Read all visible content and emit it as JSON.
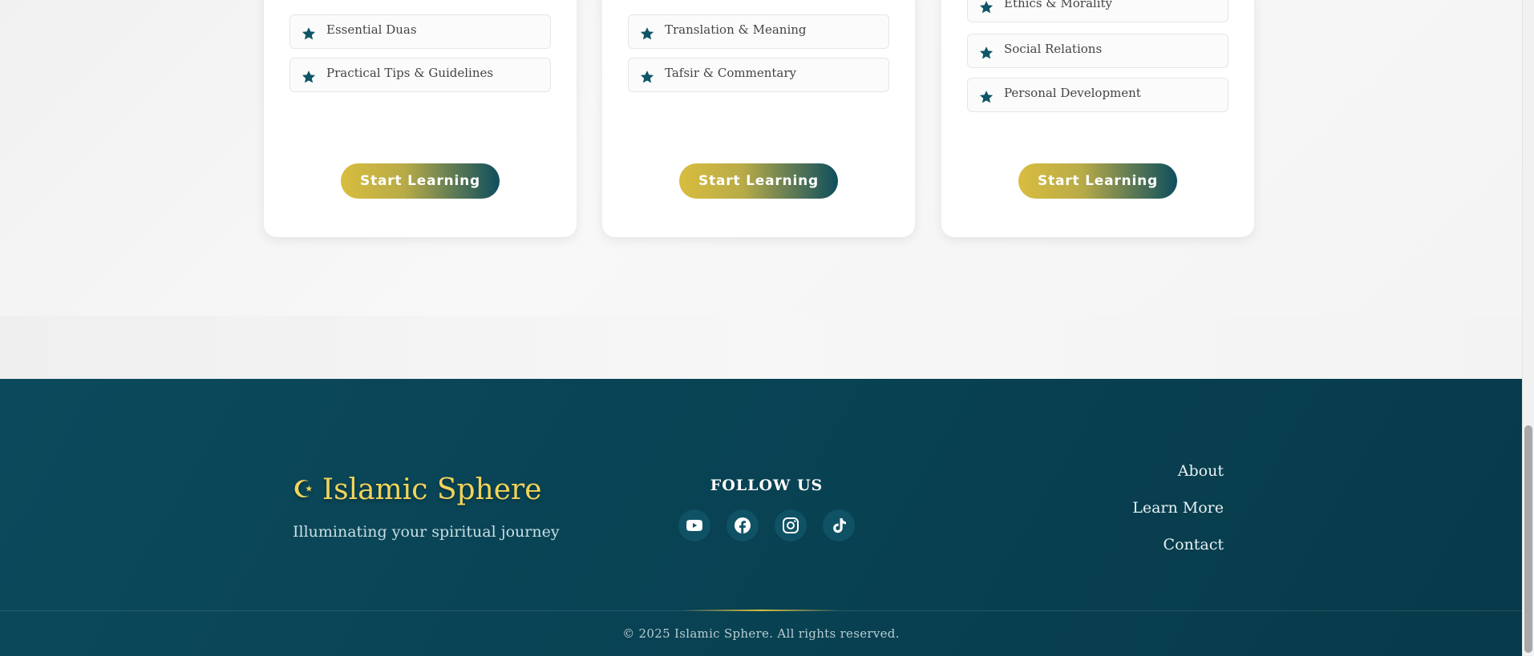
{
  "cards": [
    {
      "topics": [
        "Essential Duas",
        "Practical Tips & Guidelines"
      ],
      "button": "Start Learning"
    },
    {
      "topics": [
        "Translation & Meaning",
        "Tafsir & Commentary"
      ],
      "button": "Start Learning"
    },
    {
      "topics": [
        "Ethics & Morality",
        "Social Relations",
        "Personal Development"
      ],
      "button": "Start Learning"
    }
  ],
  "footer": {
    "brand_icon": "☪",
    "brand_name": "Islamic Sphere",
    "tagline": "Illuminating your spiritual journey",
    "follow_title": "FOLLOW US",
    "socials": [
      "youtube-icon",
      "facebook-icon",
      "instagram-icon",
      "tiktok-icon"
    ],
    "links": [
      "About",
      "Learn More",
      "Contact"
    ],
    "copyright": "© 2025 Islamic Sphere. All rights reserved."
  },
  "colors": {
    "accent_gold": "#d8bd3f",
    "brand_teal": "#0b4a5c",
    "star_teal": "#0e5566"
  }
}
